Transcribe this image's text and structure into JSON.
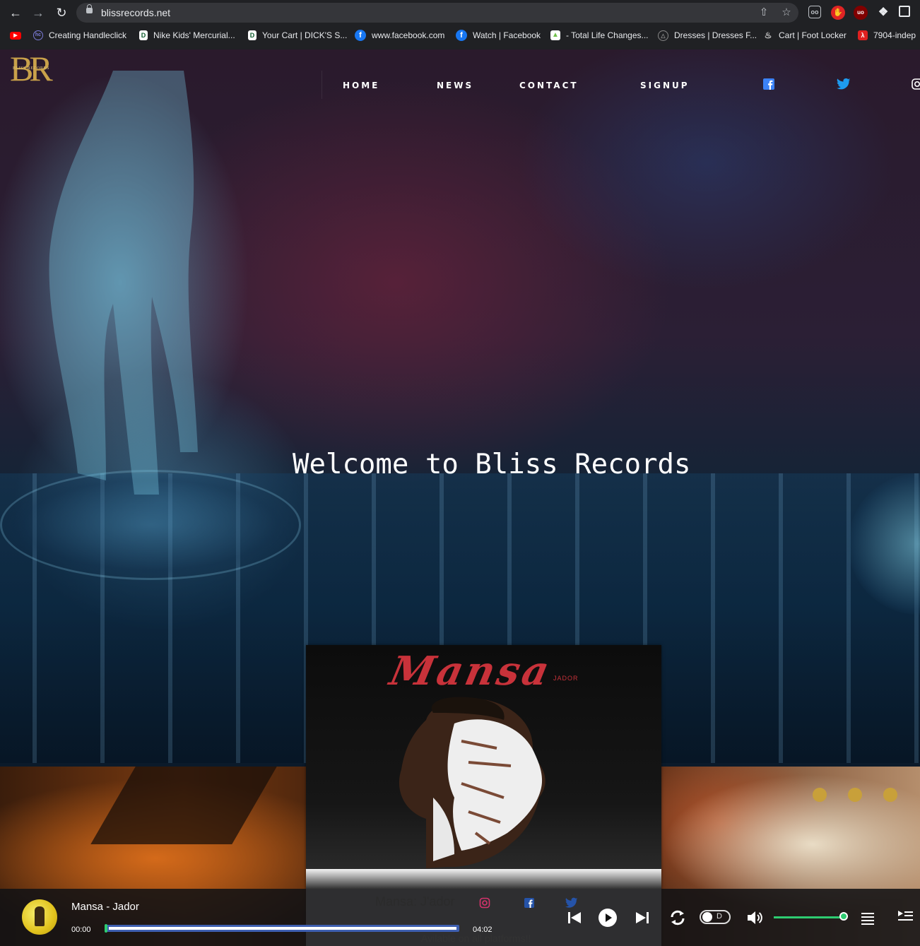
{
  "browser": {
    "url": "blissrecords.net",
    "bookmarks": [
      {
        "label": "",
        "icon": "youtube-icon",
        "color": "#ff0000"
      },
      {
        "label": "Creating Handleclick",
        "icon": "handleclick-icon",
        "color": "#7b7bd8"
      },
      {
        "label": "Nike Kids' Mercurial...",
        "icon": "dicks-icon",
        "color": "#ffffff"
      },
      {
        "label": "Your Cart | DICK'S S...",
        "icon": "dicks-icon",
        "color": "#ffffff"
      },
      {
        "label": "www.facebook.com",
        "icon": "facebook-icon",
        "color": "#1877f2"
      },
      {
        "label": "Watch | Facebook",
        "icon": "facebook-icon",
        "color": "#1877f2"
      },
      {
        "label": "- Total Life Changes...",
        "icon": "tlc-icon",
        "color": "#6fbf4a"
      },
      {
        "label": "Dresses | Dresses F...",
        "icon": "dresses-icon",
        "color": "#888888"
      },
      {
        "label": "Cart | Foot Locker",
        "icon": "footlocker-icon",
        "color": "#cccccc"
      },
      {
        "label": "7904-indep",
        "icon": "acrobat-icon",
        "color": "#e02020"
      }
    ]
  },
  "site": {
    "logo": "BR",
    "logo_sub": "BLISS RECORDS",
    "nav": {
      "home": "HOME",
      "news": "NEWS",
      "contact": "CONTACT",
      "signup": "SIGNUP"
    },
    "hero_title": "Welcome to Bliss Records",
    "album": {
      "title": "Mansa",
      "artist": "JADOR",
      "caption": "Mansa: J'ador",
      "footer": "Avilable on all platforms!!"
    }
  },
  "player": {
    "track": "Mansa - Jador",
    "current_time": "00:00",
    "duration": "04:02",
    "progress": 0,
    "volume": 1.0,
    "toggle_label": "D"
  },
  "colors": {
    "accent_blue": "#3e5fb0",
    "accent_green": "#2ecc71",
    "album_red": "#c8323a",
    "logo_gold": "#c9a14a",
    "facebook_blue": "#3b82f6",
    "twitter_blue": "#1d9bf0"
  }
}
